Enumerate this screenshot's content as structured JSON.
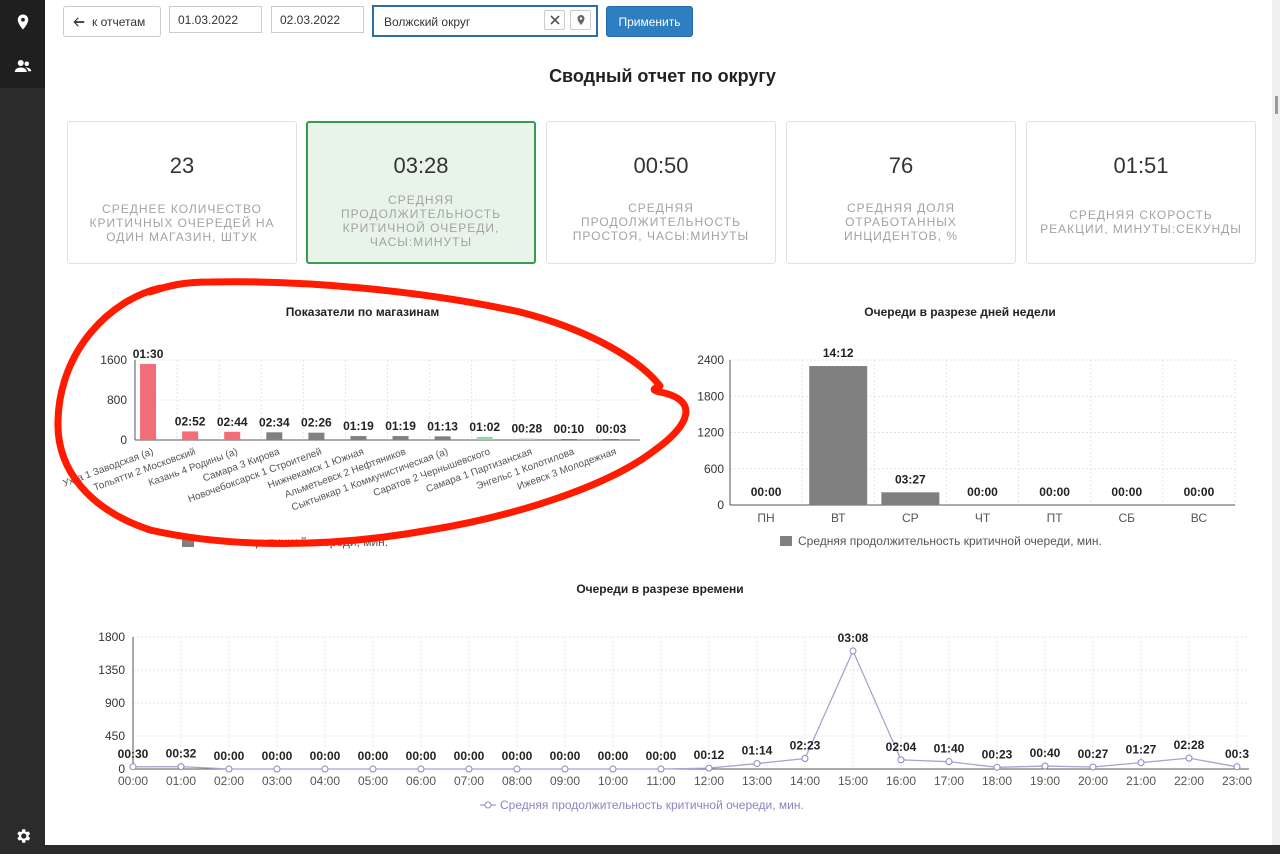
{
  "toolbar": {
    "back_label": "к отчетам",
    "date_from": "01.03.2022",
    "date_to": "02.03.2022",
    "region": "Волжский округ",
    "apply_label": "Применить"
  },
  "page_title": "Сводный отчет по округу",
  "kpis": [
    {
      "value": "23",
      "label": "Среднее количество критичных очередей на один магазин, штук"
    },
    {
      "value": "03:28",
      "label": "Средняя продолжительность критичной очереди, часы:минуты"
    },
    {
      "value": "00:50",
      "label": "Средняя продолжительность простоя, часы:минуты"
    },
    {
      "value": "76",
      "label": "Средняя доля отработанных инцидентов, %"
    },
    {
      "value": "01:51",
      "label": "Средняя скорость реакции, минуты:секунды"
    }
  ],
  "colors": {
    "accent": "#2d7fc1",
    "active_kpi_bg": "#e8f4ea",
    "active_kpi_border": "#3a9b4c",
    "bar_red": "#f26d77",
    "bar_gray": "#808080",
    "bar_green": "#8fd9a0",
    "line": "#a8a3d1",
    "annotation": "#ff1a00"
  },
  "chart_data": [
    {
      "type": "bar",
      "title": "Показатели по магазинам",
      "categories": [
        "Ухта 1 Заводская (а)",
        "Тольятти 2 Московский",
        "Казань 4 Родины (а)",
        "Самара 3 Кирова",
        "Новочебоксарск 1 Строителей",
        "Нижнекамск 1 Южная",
        "Альметьевск 2 Нефтяников",
        "Сыктывкар 1 Коммунистическая (а)",
        "Саратов 2 Чернышевского",
        "Самара 1 Партизанская",
        "Энгельс 1 Колотилова",
        "Ижевск 3 Молодежная"
      ],
      "values": [
        1520,
        172,
        164,
        154,
        146,
        79,
        79,
        73,
        62,
        28,
        10,
        3
      ],
      "data_labels": [
        "01:30",
        "02:52",
        "02:44",
        "02:34",
        "02:26",
        "01:19",
        "01:19",
        "01:13",
        "01:02",
        "00:28",
        "00:10",
        "00:03"
      ],
      "bar_colors": [
        "#f26d77",
        "#f26d77",
        "#f26d77",
        "#808080",
        "#808080",
        "#808080",
        "#808080",
        "#808080",
        "#8fd9a0",
        "#8fd9a0",
        "#808080",
        "#808080"
      ],
      "yticks": [
        0,
        800,
        1600
      ],
      "ylim": [
        0,
        1600
      ],
      "legend": "Средняя продолжительность критичной очереди, мин.",
      "legend_visible_text": "критичной очереди, мин."
    },
    {
      "type": "bar",
      "title": "Очереди в разрезе дней недели",
      "categories": [
        "ПН",
        "ВТ",
        "СР",
        "ЧТ",
        "ПТ",
        "СБ",
        "ВС"
      ],
      "values": [
        0,
        2300,
        210,
        0,
        0,
        0,
        0
      ],
      "data_labels": [
        "00:00",
        "14:12",
        "03:27",
        "00:00",
        "00:00",
        "00:00",
        "00:00"
      ],
      "yticks": [
        0,
        600,
        1200,
        1800,
        2400
      ],
      "ylim": [
        0,
        2400
      ],
      "legend": "Средняя продолжительность критичной очереди, мин."
    },
    {
      "type": "line",
      "title": "Очереди в разрезе времени",
      "x": [
        "00:00",
        "01:00",
        "02:00",
        "03:00",
        "04:00",
        "05:00",
        "06:00",
        "07:00",
        "08:00",
        "09:00",
        "10:00",
        "11:00",
        "12:00",
        "13:00",
        "14:00",
        "15:00",
        "16:00",
        "17:00",
        "18:00",
        "19:00",
        "20:00",
        "21:00",
        "22:00",
        "23:00"
      ],
      "values": [
        30,
        32,
        0,
        0,
        0,
        0,
        0,
        0,
        0,
        0,
        0,
        0,
        12,
        74,
        143,
        1610,
        124,
        100,
        23,
        40,
        27,
        87,
        148,
        30
      ],
      "data_labels": [
        "00:30",
        "00:32",
        "00:00",
        "00:00",
        "00:00",
        "00:00",
        "00:00",
        "00:00",
        "00:00",
        "00:00",
        "00:00",
        "00:00",
        "00:12",
        "01:14",
        "02:23",
        "03:08",
        "02:04",
        "01:40",
        "00:23",
        "00:40",
        "00:27",
        "01:27",
        "02:28",
        "00:3"
      ],
      "yticks": [
        0,
        450,
        900,
        1350,
        1800
      ],
      "ylim": [
        0,
        1800
      ],
      "legend": "Средняя продолжительность критичной очереди, мин."
    }
  ]
}
